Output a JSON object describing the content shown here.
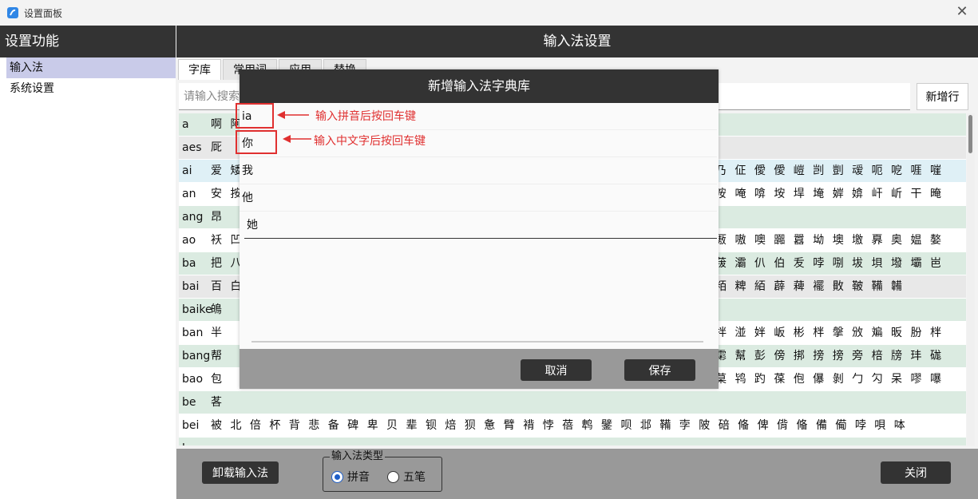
{
  "window": {
    "title": "设置面板",
    "close_glyph": "✕"
  },
  "sidebar": {
    "header": "设置功能",
    "items": [
      {
        "label": "输入法"
      },
      {
        "label": "系统设置"
      }
    ]
  },
  "main": {
    "header": "输入法设置",
    "tabs": [
      {
        "label": "字库"
      },
      {
        "label": "常用词"
      },
      {
        "label": "应用"
      },
      {
        "label": "替换"
      }
    ],
    "search_placeholder": "请输入搜索",
    "add_row_label": "新增行"
  },
  "table": {
    "rows": [
      {
        "py": "a",
        "chars": "啊 阿"
      },
      {
        "py": "aes",
        "chars": "厑"
      },
      {
        "py": "ai",
        "chars": "爱 矮",
        "tail": "乃 佂 僾 僾 嵦 剀 剴 叆 呃 呝 啀 嘊"
      },
      {
        "py": "an",
        "chars": "安 按",
        "tail": "咹 唵 啽 垵 垾 埯 婩 媕 屽 岓 干 晻"
      },
      {
        "py": "ang",
        "chars": "昂",
        "tail": ""
      },
      {
        "py": "ao",
        "chars": "袄 凹",
        "tail": "厫 嗷 噢 嚻 囂 坳 墺 墽 奡 奥 媪 嫯"
      },
      {
        "py": "ba",
        "chars": "把 八",
        "tail": "菝 灞 仈 伯 叐 哱 哵 坺 垻 墢 壩 岜"
      },
      {
        "py": "bai",
        "chars": "百 白",
        "tail": "粨 粺 絔 薜 薭 襬 贁 鞁 鞴 韛"
      },
      {
        "py": "baike",
        "chars": "䳆",
        "tail": ""
      },
      {
        "py": "ban",
        "chars": "半",
        "tail": "拌 湴 姅 岅 彬 柈 搫 攽 斒 昄 朌 柈"
      },
      {
        "py": "bang",
        "chars": "帮",
        "tail": "霦 幫 彭 傍 挷 搒 搒 旁 棓 牓 玤 硥"
      },
      {
        "py": "bao",
        "chars": "包",
        "tail": "菒 鸨 趵 葆 佨 儤 剝 勹 勽 呆 嘐 嚗"
      },
      {
        "py": "be",
        "chars": "茖",
        "tail": ""
      },
      {
        "py": "bei",
        "chars": "被 北 倍 杯 背 悲 备 碑 卑 贝 辈 钡 焙 狈 惫 臂 褙 悖 蓓 鹎 鐾 呗 邶 鞴 孛 陂 碚 偹 俾 偝 偹 備 僃 哱 唄 呠",
        "tail": ""
      },
      {
        "py": "b",
        "chars": "",
        "tail": ""
      }
    ]
  },
  "bottom": {
    "uninstall_label": "卸载输入法",
    "type_legend": "输入法类型",
    "type_options": [
      {
        "label": "拼音",
        "checked": true
      },
      {
        "label": "五笔",
        "checked": false
      }
    ],
    "close_label": "关闭"
  },
  "dialog": {
    "title": "新增输入法字典库",
    "items": [
      {
        "value": "ia"
      },
      {
        "value": "你"
      },
      {
        "value": "我"
      },
      {
        "value": "他"
      },
      {
        "value": "她"
      }
    ],
    "cancel_label": "取消",
    "save_label": "保存"
  },
  "annotations": {
    "pinyin_hint": "输入拼音后按回车键",
    "chinese_hint": "输入中文字后按回车键"
  },
  "colors": {
    "accent": "#1e5fc8",
    "annotation": "#e03030",
    "dark_header": "#333333"
  }
}
